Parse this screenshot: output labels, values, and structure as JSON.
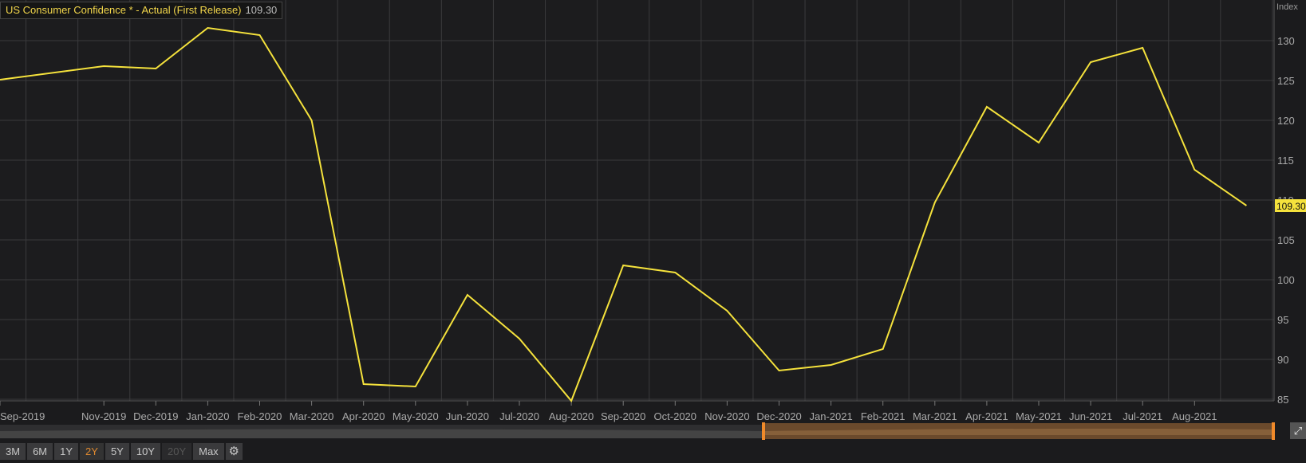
{
  "header": {
    "title": "US Consumer Confidence * - Actual (First Release)",
    "last_value": "109.30"
  },
  "chart_data": {
    "type": "line",
    "title": "US Consumer Confidence * - Actual (First Release)",
    "ylabel": "Index",
    "ylim": [
      85,
      132
    ],
    "yticks": [
      85,
      90,
      95,
      100,
      105,
      110,
      115,
      120,
      125,
      130
    ],
    "xticks": [
      "Sep-2019",
      "Nov-2019",
      "Dec-2019",
      "Jan-2020",
      "Feb-2020",
      "Mar-2020",
      "Apr-2020",
      "May-2020",
      "Jun-2020",
      "Jul-2020",
      "Aug-2020",
      "Sep-2020",
      "Oct-2020",
      "Nov-2020",
      "Dec-2020",
      "Jan-2021",
      "Feb-2021",
      "Mar-2021",
      "Apr-2021",
      "May-2021",
      "Jun-2021",
      "Jul-2021",
      "Aug-2021"
    ],
    "xtick_month_index": [
      0,
      2,
      3,
      4,
      5,
      6,
      7,
      8,
      9,
      10,
      11,
      12,
      13,
      14,
      15,
      16,
      17,
      18,
      19,
      20,
      21,
      22,
      23
    ],
    "series": [
      {
        "name": "US Consumer Confidence",
        "color": "#f5e23c",
        "month_index": [
          0,
          2,
          3,
          4,
          5,
          6,
          7,
          8,
          9,
          10,
          11,
          12,
          13,
          14,
          15,
          16,
          17,
          18,
          19,
          20,
          21,
          22,
          23,
          24
        ],
        "values": [
          125.1,
          126.8,
          126.5,
          131.6,
          130.7,
          120.0,
          86.9,
          86.6,
          98.1,
          92.6,
          84.8,
          101.8,
          100.9,
          96.1,
          88.6,
          89.3,
          91.3,
          109.7,
          121.7,
          117.2,
          127.3,
          129.1,
          113.8,
          109.3
        ]
      }
    ],
    "last_label": "109.30",
    "grid": true
  },
  "toolbar": {
    "ranges": [
      "3M",
      "6M",
      "1Y",
      "2Y",
      "5Y",
      "10Y",
      "20Y",
      "Max"
    ],
    "active": "2Y",
    "disabled": [
      "20Y"
    ]
  }
}
